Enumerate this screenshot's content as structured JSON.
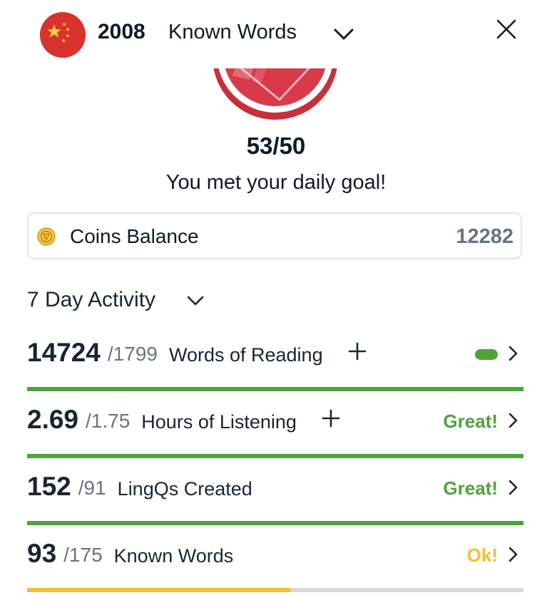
{
  "header": {
    "known_words_count": "2008",
    "known_words_label": "Known Words",
    "flag_icon": "china-flag-icon",
    "dropdown_icon": "chevron-down-icon",
    "close_icon": "close-icon"
  },
  "daily_goal": {
    "progress_text": "53/50",
    "message": "You met your daily goal!"
  },
  "coins": {
    "label": "Coins Balance",
    "value": "12282",
    "icon": "coin-icon"
  },
  "activity": {
    "title": "7 Day Activity",
    "colors": {
      "green": "#4ea43a",
      "yellow": "#f5bb3a",
      "track": "#d9d9d9"
    },
    "rows": [
      {
        "value": "14724",
        "target": "/1799",
        "label": "Words of Reading",
        "has_plus": true,
        "status": "",
        "status_color": "#4ea43a",
        "show_pill": true,
        "progress": 1.0,
        "bar_color": "#4ea43a"
      },
      {
        "value": "2.69",
        "target": "/1.75",
        "label": "Hours of Listening",
        "has_plus": true,
        "status": "Great!",
        "status_color": "#4ea43a",
        "show_pill": false,
        "progress": 1.0,
        "bar_color": "#4ea43a"
      },
      {
        "value": "152",
        "target": "/91",
        "label": "LingQs Created",
        "has_plus": false,
        "status": "Great!",
        "status_color": "#4ea43a",
        "show_pill": false,
        "progress": 1.0,
        "bar_color": "#4ea43a"
      },
      {
        "value": "93",
        "target": "/175",
        "label": "Known Words",
        "has_plus": false,
        "status": "Ok!",
        "status_color": "#f5bb3a",
        "show_pill": false,
        "progress": 0.53,
        "bar_color": "#f5bb3a"
      }
    ]
  }
}
